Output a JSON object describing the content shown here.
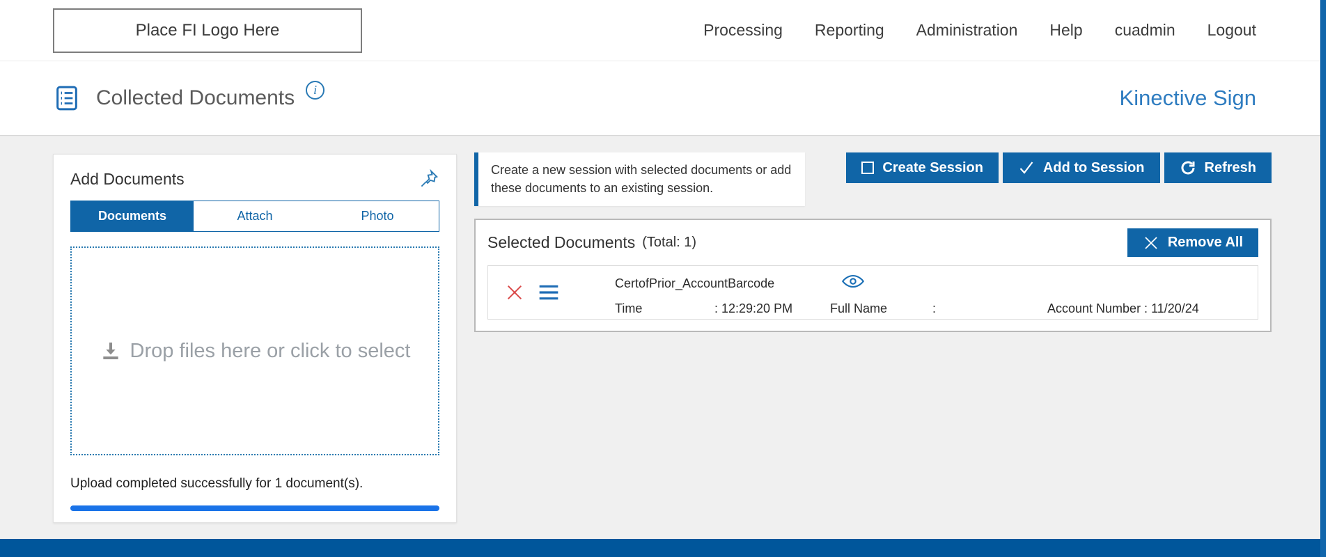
{
  "header": {
    "logo_text": "Place FI Logo Here",
    "nav": [
      "Processing",
      "Reporting",
      "Administration",
      "Help",
      "cuadmin",
      "Logout"
    ]
  },
  "page": {
    "title": "Collected Documents",
    "info_icon": "i",
    "brand": "Kinective Sign"
  },
  "add_documents": {
    "title": "Add Documents",
    "tabs": [
      "Documents",
      "Attach",
      "Photo"
    ],
    "active_tab": "Documents",
    "dropzone_text": "Drop files here or click to select",
    "upload_status": "Upload completed successfully for 1 document(s)."
  },
  "session_panel": {
    "info_message": "Create a new session with selected documents or add these documents to an existing session.",
    "buttons": {
      "create_session": "Create Session",
      "add_to_session": "Add to Session",
      "refresh": "Refresh"
    },
    "selected_documents": {
      "title": "Selected Documents",
      "total_label": "(Total: 1)",
      "remove_all_label": "Remove All",
      "rows": [
        {
          "name": "CertofPrior_AccountBarcode",
          "time_label": "Time",
          "time_value": ": 12:29:20 PM",
          "full_name_label": "Full Name",
          "full_name_value": ":",
          "account_text": "Account Number : 11/20/24"
        }
      ]
    }
  },
  "colors": {
    "primary_blue": "#1065a7",
    "brand_blue": "#2e7cc0",
    "footer_blue": "#00569b",
    "progress_blue": "#1a73e8",
    "delete_red": "#d94545"
  }
}
